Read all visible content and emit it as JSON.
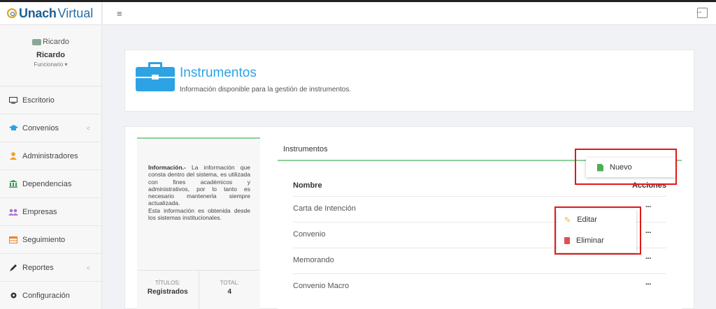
{
  "brand": {
    "part1": "Unach",
    "part2": "Virtual"
  },
  "user": {
    "avatar_alt": "Ricardo",
    "name": "Ricardo",
    "role": "Funcionario ▾"
  },
  "sidebar": {
    "items": [
      {
        "label": "Escritorio",
        "icon": "monitor-icon",
        "has_chevron": false
      },
      {
        "label": "Convenios",
        "icon": "graduation-cap-icon",
        "has_chevron": true
      },
      {
        "label": "Administradores",
        "icon": "user-icon",
        "has_chevron": false
      },
      {
        "label": "Dependencias",
        "icon": "institution-icon",
        "has_chevron": false
      },
      {
        "label": "Empresas",
        "icon": "users-icon",
        "has_chevron": false
      },
      {
        "label": "Seguimiento",
        "icon": "table-icon",
        "has_chevron": false
      },
      {
        "label": "Reportes",
        "icon": "pen-icon",
        "has_chevron": true
      },
      {
        "label": "Configuración",
        "icon": "gear-icon",
        "has_chevron": false
      }
    ],
    "chevron": "<"
  },
  "topbar": {
    "menu_glyph": "≡"
  },
  "header": {
    "title": "Instrumentos",
    "subtitle": "Información disponible para la gestión de instrumentos."
  },
  "info": {
    "lead": "Información.-",
    "body": " La información que consta dentro del sistema, es utilizada con fines académicos y administrativos, por lo tanto es necesario mantenerla siempre actualizada.",
    "body2": "Esta información es obtenida desde los sistemas institucionales.",
    "stat1_label": "TÍTULOS:",
    "stat1_value": "Registrados",
    "stat2_label": "TOTAL:",
    "stat2_value": "4"
  },
  "instruments": {
    "card_title": "Instrumentos",
    "col_name": "Nombre",
    "col_actions": "Acciones",
    "rows": [
      {
        "name": "Carta de Intención",
        "action": "···"
      },
      {
        "name": "Convenio",
        "action": "···"
      },
      {
        "name": "Memorando",
        "action": "···"
      },
      {
        "name": "Convenio Macro",
        "action": "···"
      }
    ]
  },
  "popover_new": {
    "label": "Nuevo"
  },
  "popover_actions": {
    "edit": "Editar",
    "delete": "Eliminar"
  },
  "colors": {
    "accent": "#2da3e3",
    "success_line": "#8ccf9b",
    "highlight": "#e01818"
  }
}
